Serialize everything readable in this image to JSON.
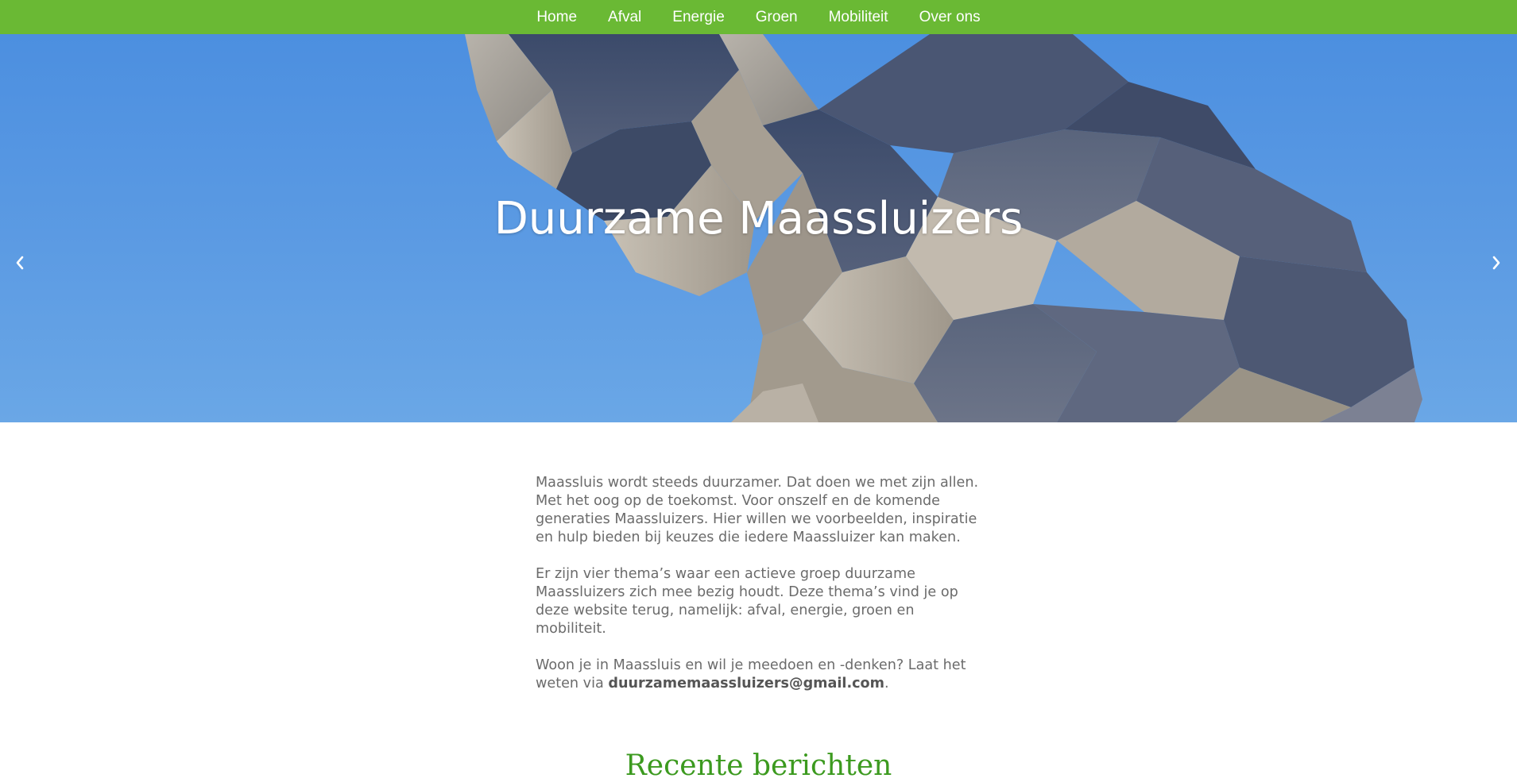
{
  "nav": {
    "items": [
      {
        "label": "Home"
      },
      {
        "label": "Afval"
      },
      {
        "label": "Energie"
      },
      {
        "label": "Groen"
      },
      {
        "label": "Mobiliteit"
      },
      {
        "label": "Over ons"
      }
    ]
  },
  "hero": {
    "title": "Duurzame Maassluizers",
    "prev_icon": "chevron-left-icon",
    "next_icon": "chevron-right-icon"
  },
  "content": {
    "p1": "Maassluis wordt steeds duurzamer. Dat doen we met zijn allen. Met het oog op de toekomst. Voor onszelf en de komende generaties Maassluizers. Hier willen we voorbeelden, inspiratie en hulp bieden bij keuzes die iedere Maassluizer kan maken.",
    "p2": "Er zijn vier thema’s waar een actieve groep duurzame Maassluizers zich mee bezig houdt. Deze thema’s vind je op deze website terug, namelijk: afval, energie, groen en mobiliteit.",
    "p3_before": "Woon je in Maassluis en wil je meedoen en -denken? Laat het weten via ",
    "email": "duurzamemaassluizers@gmail.com",
    "p3_after": "."
  },
  "recent": {
    "heading": "Recente berichten"
  },
  "colors": {
    "nav_bg": "#6ab934",
    "heading_green": "#3c9a1f",
    "sky": "#5c9be3"
  }
}
